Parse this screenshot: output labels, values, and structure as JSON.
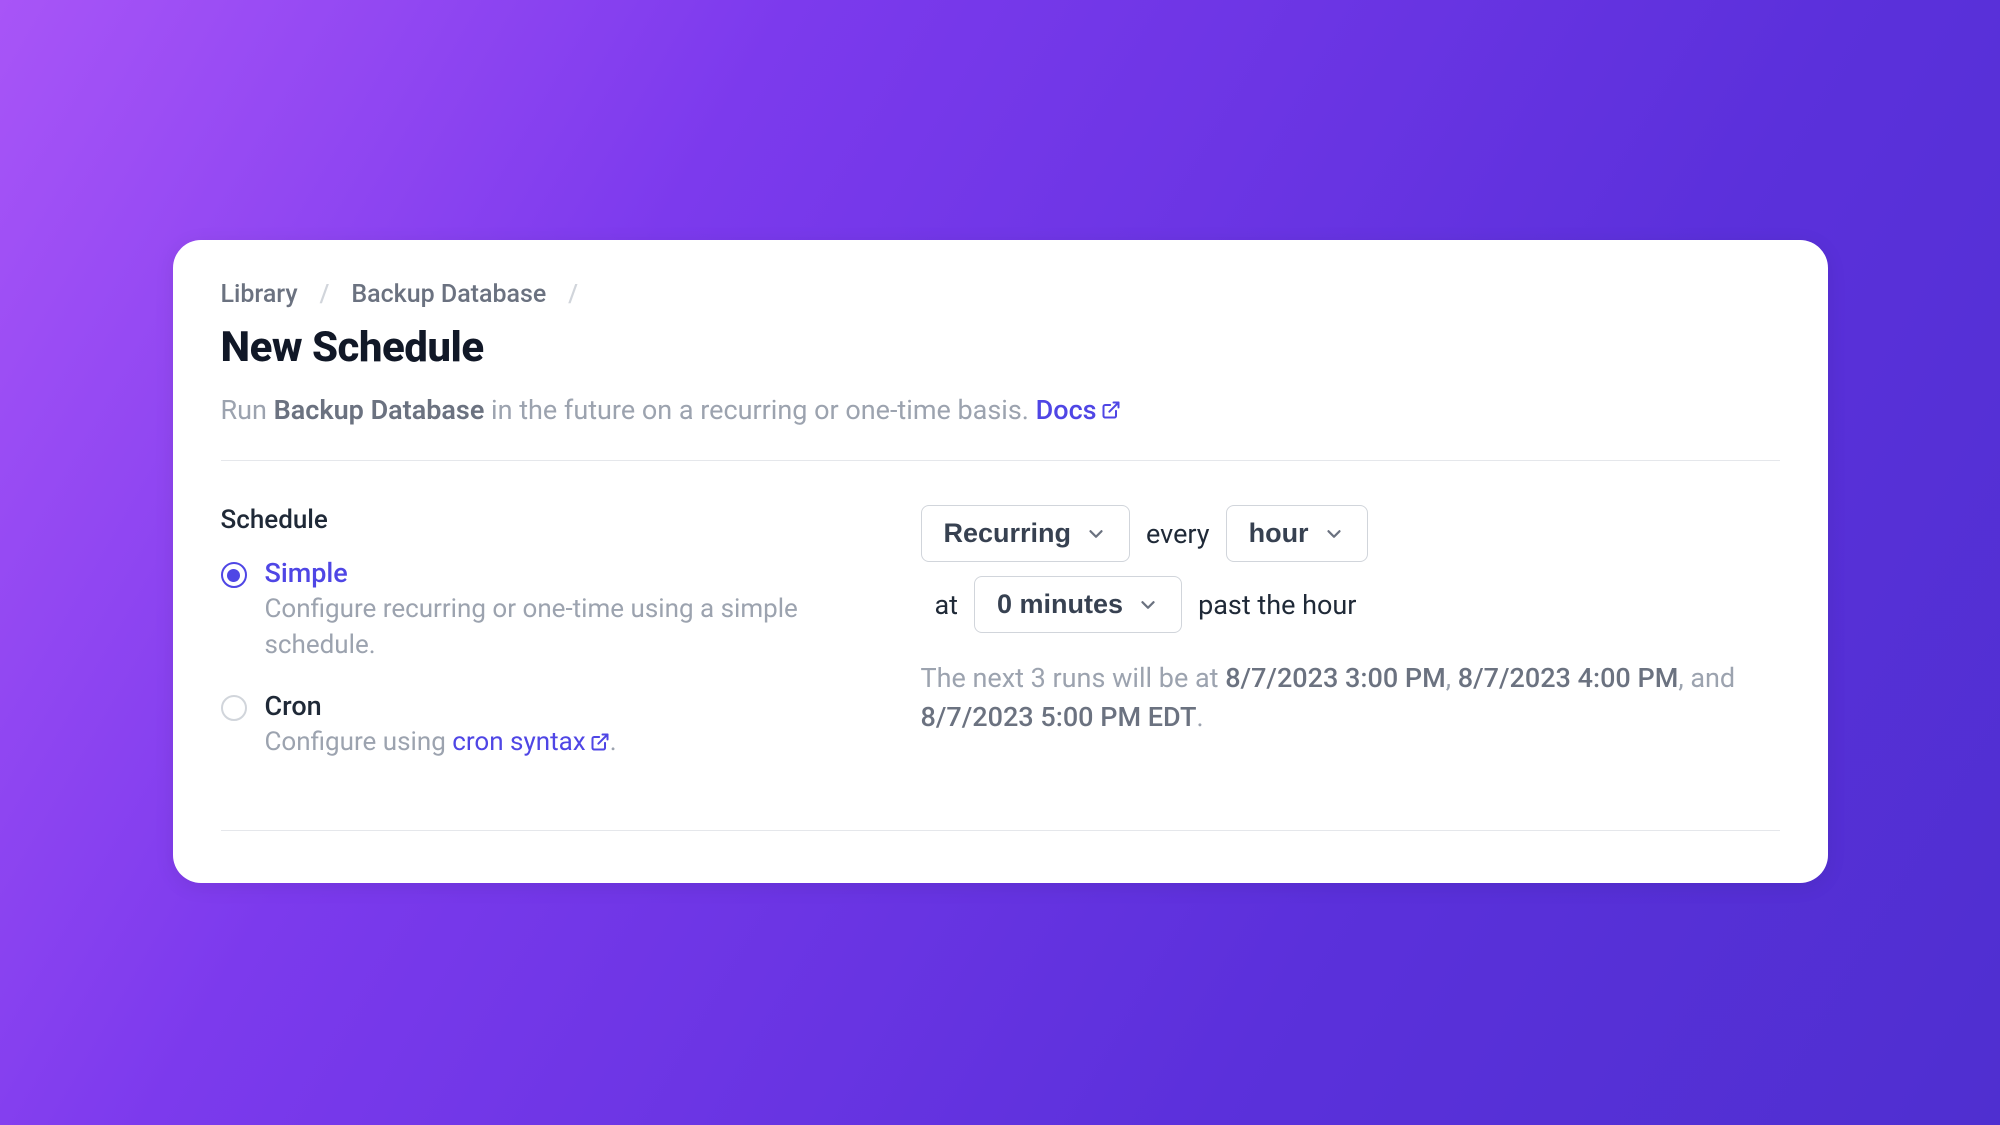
{
  "breadcrumb": {
    "item1": "Library",
    "item2": "Backup Database"
  },
  "page_title": "New Schedule",
  "description": {
    "pre": "Run ",
    "name": "Backup Database",
    "post": " in the future on a recurring or one-time basis. ",
    "docs": "Docs"
  },
  "section_label": "Schedule",
  "options": {
    "simple": {
      "title": "Simple",
      "desc": "Configure recurring or one-time using a simple schedule."
    },
    "cron": {
      "title": "Cron",
      "desc_pre": "Configure using ",
      "link": "cron syntax",
      "desc_post": "."
    }
  },
  "controls": {
    "recurring": "Recurring",
    "every": "every",
    "unit": "hour",
    "at": "at",
    "minutes": "0 minutes",
    "past": "past the hour"
  },
  "next_runs": {
    "pre": "The next 3 runs will be at ",
    "t1": "8/7/2023 3:00 PM",
    "sep1": ", ",
    "t2": "8/7/2023 4:00 PM",
    "sep2": ", and ",
    "t3": "8/7/2023 5:00 PM EDT",
    "post": "."
  }
}
